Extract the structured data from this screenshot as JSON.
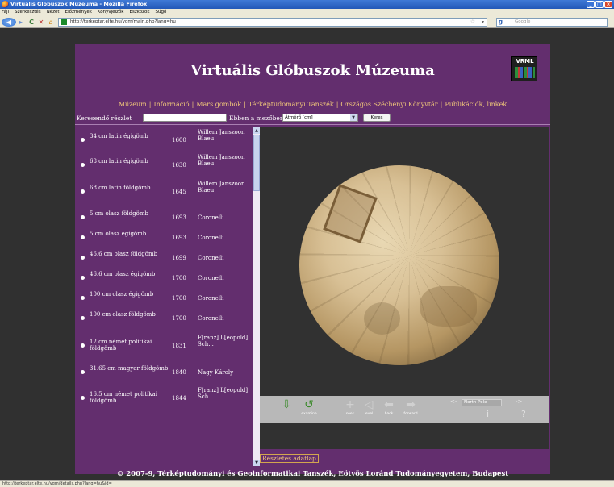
{
  "browser": {
    "window_title": "Virtuális Glóbuszok Múzeuma - Mozilla Firefox",
    "menu": [
      "Fájl",
      "Szerkesztés",
      "Nézet",
      "Előzmények",
      "Könyvjelzők",
      "Eszközök",
      "Súgó"
    ],
    "url": "http://terkeptar.elte.hu/vgm/main.php?lang=hu",
    "search_placeholder": "Google",
    "search_engine_glyph": "g",
    "status_url": "http://terkeptar.elte.hu/vgm/details.php?lang=hu&id="
  },
  "page": {
    "title": "Virtuális Glóbuszok Múzeuma",
    "logo_text": "VRML",
    "nav": [
      "Múzeum",
      "Információ",
      "Mars gombok",
      "Térképtudományi Tanszék",
      "Országos Széchényi Könyvtár",
      "Publikációk, linkek"
    ],
    "search": {
      "label": "Keresendő részlet",
      "value": "",
      "in_field_label": "Ebben a mezőben",
      "field_selected": "Átmérő [cm]",
      "button": "Keres"
    },
    "globes": [
      {
        "name": "34 cm latin égigömb",
        "year": "1600",
        "author": "Willem Janszoon Blaeu"
      },
      {
        "name": "68 cm latin égigömb",
        "year": "1630",
        "author": "Willem Janszoon Blaeu"
      },
      {
        "name": "68 cm latin földgömb",
        "year": "1645",
        "author": "Willem Janszoon Blaeu"
      },
      {
        "name": "5 cm olasz földgömb",
        "year": "1693",
        "author": "Coronelli"
      },
      {
        "name": "5 cm olasz égigömb",
        "year": "1693",
        "author": "Coronelli"
      },
      {
        "name": "46.6 cm olasz földgömb",
        "year": "1699",
        "author": "Coronelli"
      },
      {
        "name": "46.6 cm olasz égigömb",
        "year": "1700",
        "author": "Coronelli"
      },
      {
        "name": "100 cm olasz égigömb",
        "year": "1700",
        "author": "Coronelli"
      },
      {
        "name": "100 cm olasz földgömb",
        "year": "1700",
        "author": "Coronelli"
      },
      {
        "name": "12 cm német politikai földgömb",
        "year": "1831",
        "author": "F[ranz] L[eopold] Sch..."
      },
      {
        "name": "31.65 cm magyar földgömb",
        "year": "1840",
        "author": "Nagy Károly"
      },
      {
        "name": "16.5 cm német politikai földgömb",
        "year": "1844",
        "author": "F[ranz] L[eopold] Sch..."
      }
    ],
    "viewer_controls": {
      "examine": "examine",
      "seek": "seek",
      "level": "level",
      "back": "back",
      "forward": "forward",
      "viewpoint": "North Pole",
      "left_arrow": "<-",
      "right_arrow": "->",
      "info": "i",
      "help": "?"
    },
    "details_button": "Részletes adatlap",
    "footer": "© 2007-9, Térképtudományi és Geoinformatikai Tanszék, Eötvös Loránd Tudományegyetem, Budapest"
  }
}
